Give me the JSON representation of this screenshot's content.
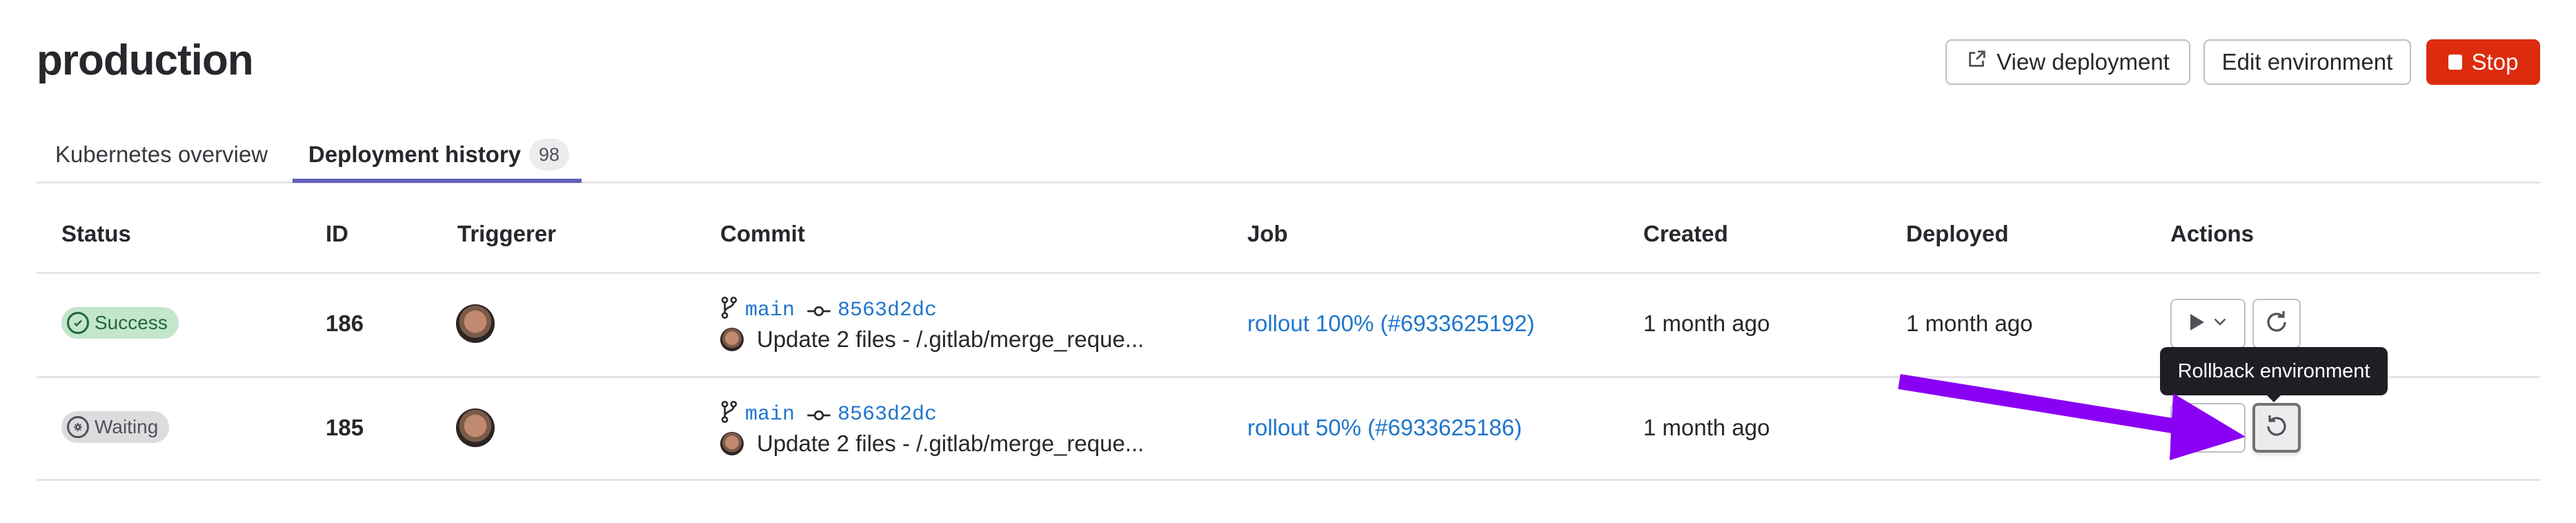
{
  "header": {
    "title": "production",
    "buttons": {
      "view_deployment": "View deployment",
      "edit_environment": "Edit environment",
      "stop": "Stop"
    }
  },
  "tabs": [
    {
      "label": "Kubernetes overview",
      "active": false
    },
    {
      "label": "Deployment history",
      "active": true,
      "count": "98"
    }
  ],
  "table": {
    "columns": [
      "Status",
      "ID",
      "Triggerer",
      "Commit",
      "Job",
      "Created",
      "Deployed",
      "Actions"
    ],
    "rows": [
      {
        "status": "Success",
        "status_icon": "check-circle-icon",
        "id": "186",
        "triggerer_avatar": "user-avatar",
        "branch": "main",
        "commit_sha": "8563d2dc",
        "commit_message": "Update 2 files - /.gitlab/merge_reque...",
        "job": "rollout 100% (#6933625192)",
        "created": "1 month ago",
        "deployed": "1 month ago",
        "actions": [
          "play-dropdown",
          "redeploy"
        ]
      },
      {
        "status": "Waiting",
        "status_icon": "gear-circle-icon",
        "id": "185",
        "triggerer_avatar": "user-avatar",
        "branch": "main",
        "commit_sha": "8563d2dc",
        "commit_message": "Update 2 files - /.gitlab/merge_reque...",
        "job": "rollout 50% (#6933625186)",
        "created": "1 month ago",
        "deployed": "",
        "actions": [
          "play-dropdown",
          "rollback"
        ]
      }
    ]
  },
  "tooltip": {
    "text": "Rollback environment"
  },
  "annotation": {
    "type": "arrow",
    "color": "#8a00f5",
    "target": "rollback-button"
  },
  "colors": {
    "accent": "#6160bb",
    "link": "#1f75cb",
    "danger": "#dd2b0e",
    "success_bg": "#c3e6cd",
    "success_text": "#24663b",
    "waiting_bg": "#dcdcde"
  }
}
